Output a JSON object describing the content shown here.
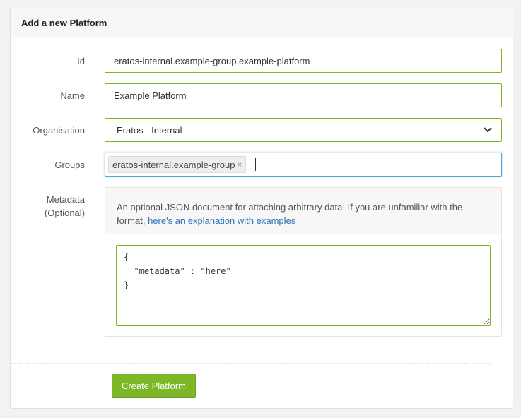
{
  "panel": {
    "title": "Add a new Platform"
  },
  "form": {
    "id": {
      "label": "Id",
      "value": "eratos-internal.example-group.example-platform"
    },
    "name": {
      "label": "Name",
      "value": "Example Platform"
    },
    "organisation": {
      "label": "Organisation",
      "selected": "Eratos - Internal"
    },
    "groups": {
      "label": "Groups",
      "tags": [
        "eratos-internal.example-group"
      ],
      "remove_glyph": "×"
    },
    "metadata": {
      "label_line1": "Metadata",
      "label_line2": "(Optional)",
      "description": "An optional JSON document for attaching arbitrary data. If you are unfamiliar with the format, ",
      "link_text": "here's an explanation with examples",
      "json_value": "{\n  \"metadata\" : \"here\"\n}"
    },
    "submit_label": "Create Platform"
  },
  "colors": {
    "accent_green": "#7cb728",
    "focus_blue": "#5aa4d6",
    "link_blue": "#2f74b5"
  },
  "icons": {
    "select_arrow": "chevron-down-icon",
    "tag_remove": "close-icon"
  }
}
